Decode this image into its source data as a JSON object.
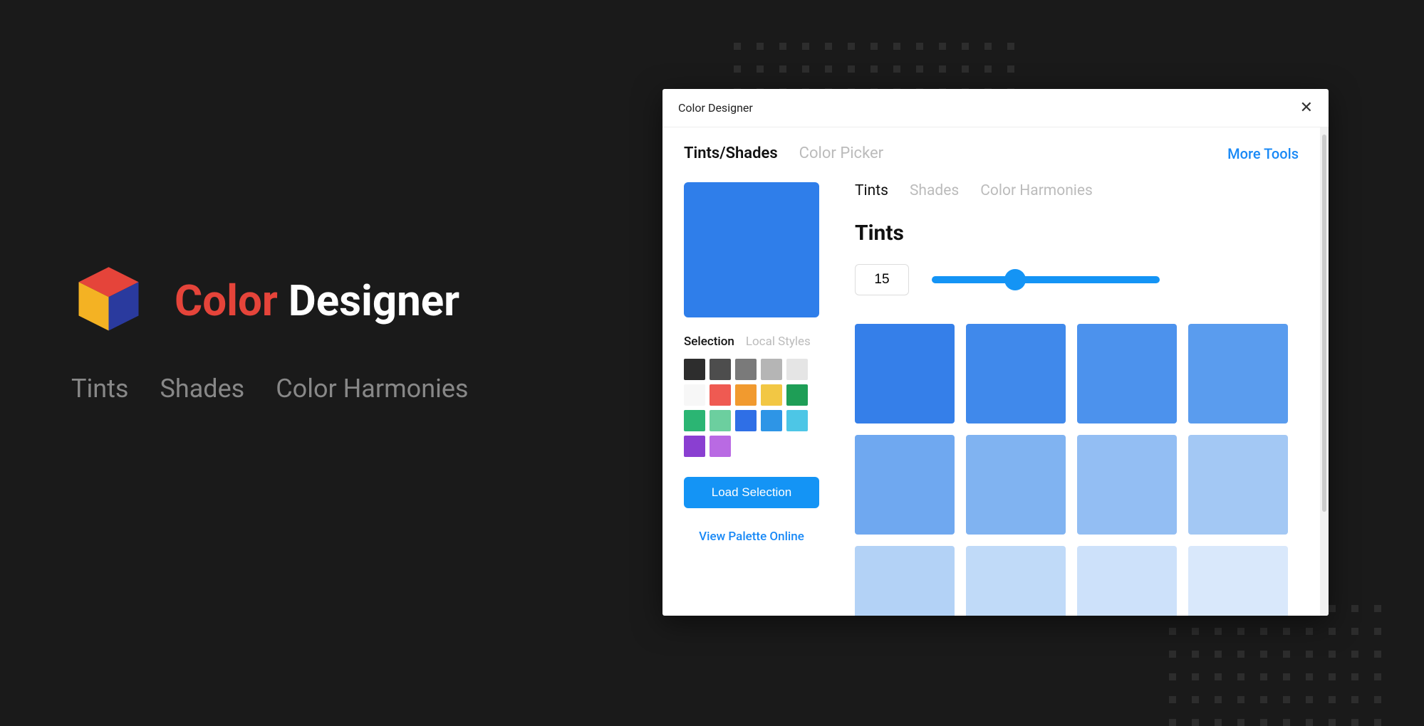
{
  "hero": {
    "title_accent": "Color",
    "title_rest": " Designer",
    "subs": [
      "Tints",
      "Shades",
      "Color Harmonies"
    ]
  },
  "window": {
    "title": "Color Designer",
    "top_tabs": [
      {
        "label": "Tints/Shades",
        "active": true
      },
      {
        "label": "Color Picker",
        "active": false
      }
    ],
    "more_tools": "More Tools",
    "big_swatch_color": "#2f7eea",
    "side_tabs": [
      {
        "label": "Selection",
        "active": true
      },
      {
        "label": "Local Styles",
        "active": false
      }
    ],
    "selection_swatches": [
      "#2d2d2d",
      "#4d4d4d",
      "#7a7a7a",
      "#b5b5b5",
      "#e5e5e5",
      "#f7f7f7",
      "#ef5a52",
      "#f19a2f",
      "#f2c744",
      "#1e9e56",
      "#2bb573",
      "#6ccf9f",
      "#2f6fe6",
      "#2e95e6",
      "#4dc6e6",
      "#8a3fd1",
      "#b96ae3"
    ],
    "load_button": "Load Selection",
    "view_link": "View Palette Online",
    "mode_tabs": [
      {
        "label": "Tints",
        "active": true
      },
      {
        "label": "Shades",
        "active": false
      },
      {
        "label": "Color Harmonies",
        "active": false
      }
    ],
    "section_title": "Tints",
    "count_value": "15",
    "tint_colors": [
      "#357fe9",
      "#4089eb",
      "#4c92ed",
      "#5a9cee",
      "#6fa8f0",
      "#80b3f1",
      "#93bef3",
      "#a3c8f4",
      "#b3d2f6",
      "#c0daf8",
      "#cde1fa",
      "#d9e8fb"
    ]
  }
}
